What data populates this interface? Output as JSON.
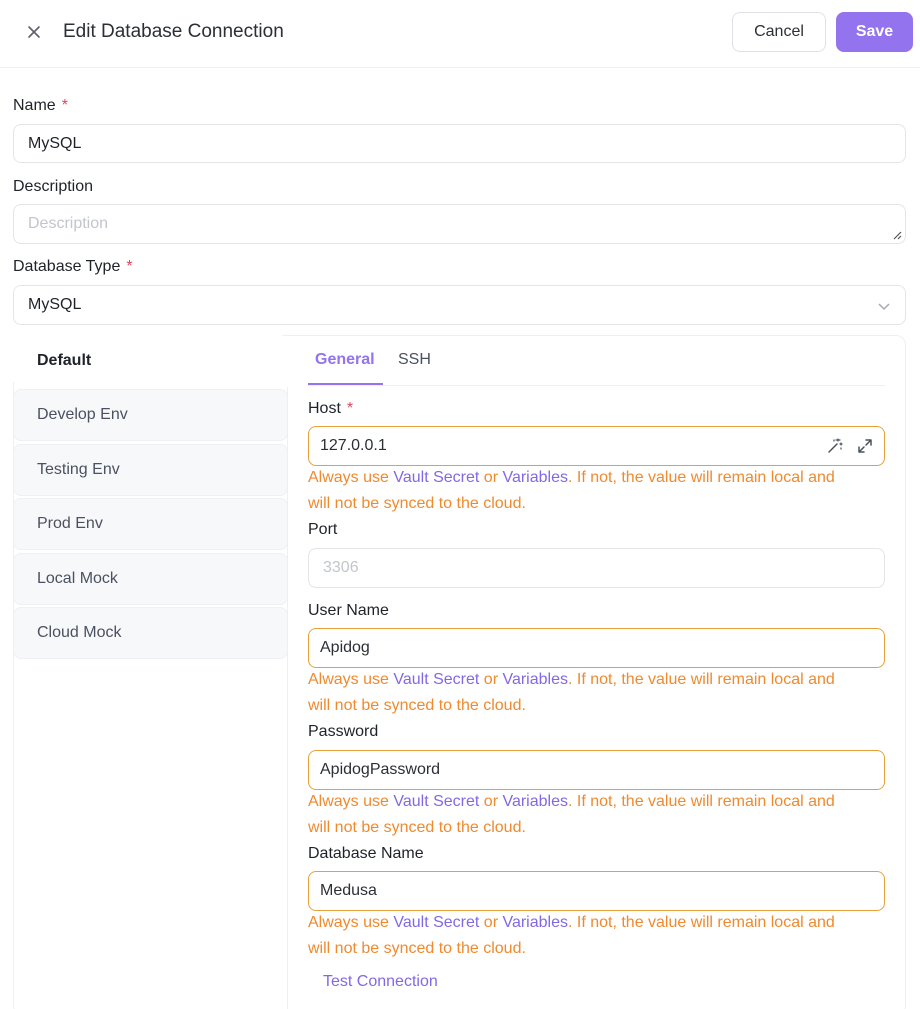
{
  "header": {
    "title": "Edit Database Connection",
    "cancel_label": "Cancel",
    "save_label": "Save",
    "close_icon": "close-icon"
  },
  "form": {
    "name": {
      "label": "Name",
      "required": "*",
      "value": "MySQL"
    },
    "description": {
      "label": "Description",
      "placeholder": "Description",
      "value": ""
    },
    "database_type": {
      "label": "Database Type",
      "required": "*",
      "value": "MySQL"
    }
  },
  "environments": [
    {
      "label": "Default",
      "active": true
    },
    {
      "label": "Develop Env",
      "active": false
    },
    {
      "label": "Testing Env",
      "active": false
    },
    {
      "label": "Prod Env",
      "active": false
    },
    {
      "label": "Local Mock",
      "active": false
    },
    {
      "label": "Cloud Mock",
      "active": false
    }
  ],
  "tabs": [
    {
      "label": "General",
      "active": true
    },
    {
      "label": "SSH",
      "active": false
    }
  ],
  "general": {
    "host": {
      "label": "Host",
      "required": "*",
      "value": "127.0.0.1"
    },
    "port": {
      "label": "Port",
      "placeholder": "3306",
      "value": ""
    },
    "user_name": {
      "label": "User Name",
      "value": "Apidog"
    },
    "password": {
      "label": "Password",
      "value": "ApidogPassword"
    },
    "database_name": {
      "label": "Database Name",
      "value": "Medusa"
    }
  },
  "warning": {
    "prefix": "Always use ",
    "link1": "Vault Secret",
    "middle": " or ",
    "link2": "Variables",
    "suffix_line1": ". If not, the value will remain local and",
    "line2": "will not be synced to the cloud."
  },
  "test_connection_label": "Test Connection",
  "colors": {
    "accent": "#9373ee",
    "warning": "#ef8a2e",
    "warning_border": "#e7a13a",
    "required": "#e0445e"
  }
}
